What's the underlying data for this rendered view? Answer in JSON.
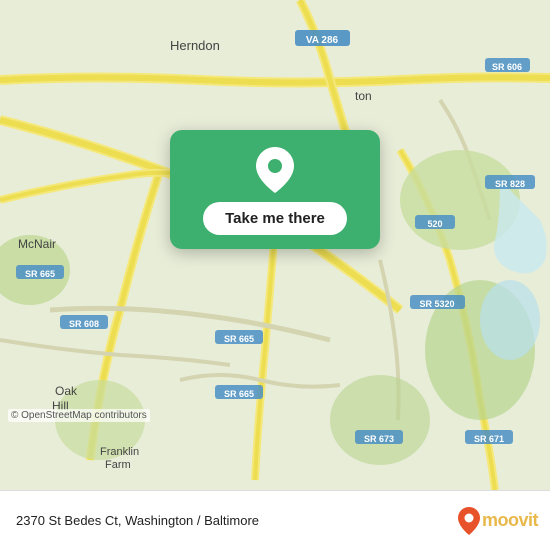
{
  "map": {
    "background_color": "#e8f0d8",
    "attribution": "© OpenStreetMap contributors"
  },
  "card": {
    "button_label": "Take me there",
    "pin_icon": "location-pin"
  },
  "bottom_bar": {
    "address": "2370 St Bedes Ct, Washington / Baltimore",
    "moovit_wordmark": "moovit"
  }
}
